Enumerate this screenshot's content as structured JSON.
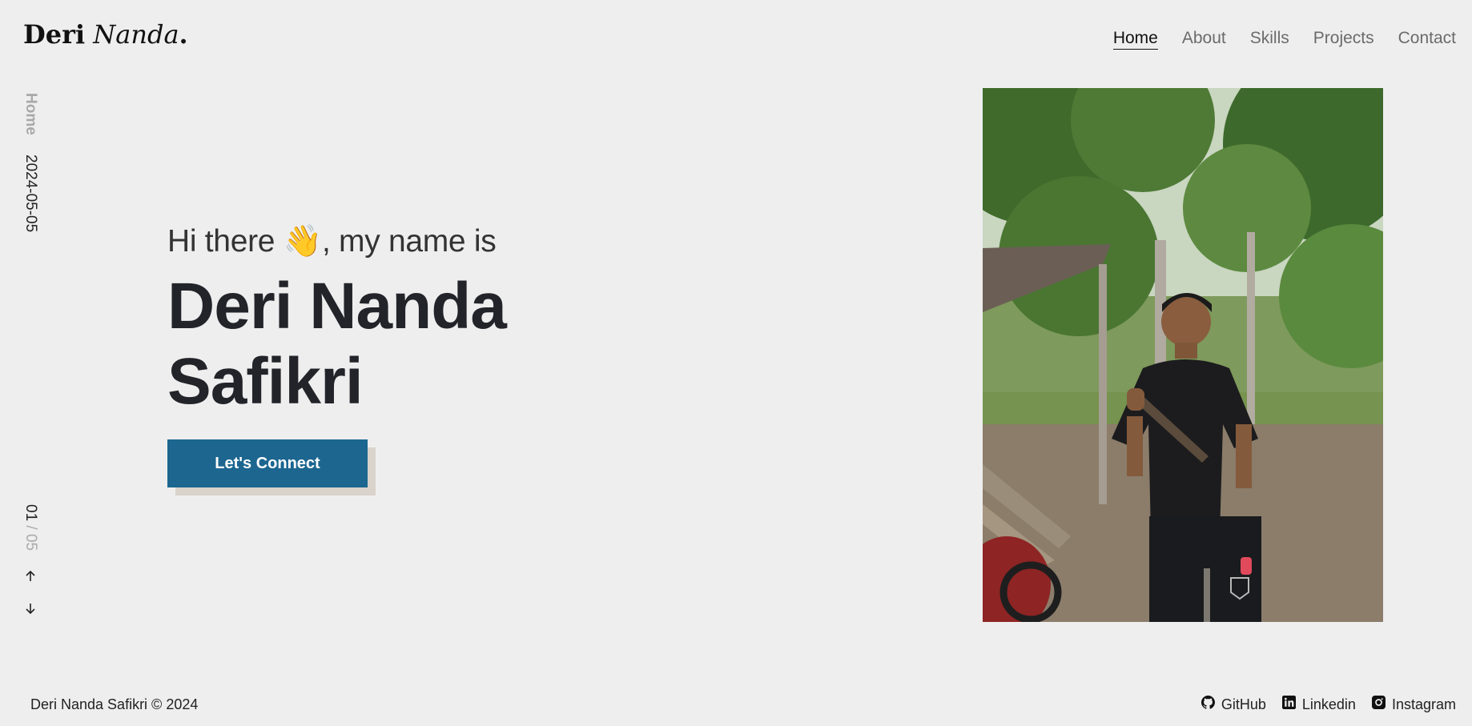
{
  "header": {
    "logo_first": "Deri",
    "logo_second": "Nanda",
    "logo_dot": ".",
    "nav": [
      {
        "label": "Home",
        "active": true
      },
      {
        "label": "About",
        "active": false
      },
      {
        "label": "Skills",
        "active": false
      },
      {
        "label": "Projects",
        "active": false
      },
      {
        "label": "Contact",
        "active": false
      }
    ]
  },
  "side": {
    "section": "Home",
    "date": "2024-05-05",
    "current": "01",
    "separator": " / ",
    "total": "05",
    "up_icon": "arrow-up-icon",
    "down_icon": "arrow-down-icon"
  },
  "hero": {
    "greeting_before": "Hi there ",
    "greeting_emoji": "👋",
    "greeting_after": ", my name is",
    "name_line1": "Deri Nanda",
    "name_line2": "Safikri",
    "cta": "Let's Connect"
  },
  "footer": {
    "copyright": "Deri Nanda Safikri © 2024",
    "links": [
      {
        "label": "GitHub",
        "icon": "github-icon"
      },
      {
        "label": "Linkedin",
        "icon": "linkedin-icon"
      },
      {
        "label": "Instagram",
        "icon": "instagram-icon"
      }
    ]
  },
  "colors": {
    "background": "#eeeeee",
    "button": "#1c6690",
    "button_shadow": "#d9d3cc",
    "text_dark": "#23242a",
    "muted": "#a9a9a9"
  }
}
